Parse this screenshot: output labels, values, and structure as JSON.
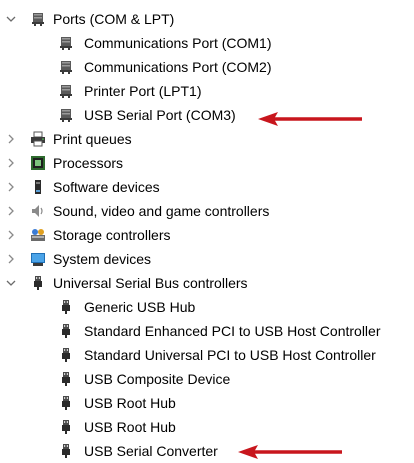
{
  "tree": {
    "ports": {
      "label": "Ports (COM & LPT)",
      "expanded": true,
      "children": [
        "Communications Port (COM1)",
        "Communications Port (COM2)",
        "Printer Port (LPT1)",
        "USB Serial Port (COM3)"
      ]
    },
    "print_queues": {
      "label": "Print queues",
      "expanded": false
    },
    "processors": {
      "label": "Processors",
      "expanded": false
    },
    "software_devices": {
      "label": "Software devices",
      "expanded": false
    },
    "sound": {
      "label": "Sound, video and game controllers",
      "expanded": false
    },
    "storage": {
      "label": "Storage controllers",
      "expanded": false
    },
    "system": {
      "label": "System devices",
      "expanded": false
    },
    "usb": {
      "label": "Universal Serial Bus controllers",
      "expanded": true,
      "children": [
        "Generic USB Hub",
        "Standard Enhanced PCI to USB Host Controller",
        "Standard Universal PCI to USB Host Controller",
        "USB Composite Device",
        "USB Root Hub",
        "USB Root Hub",
        "USB Serial Converter"
      ]
    }
  },
  "icons": {
    "ports_category": "port-connector-icon",
    "port_item": "port-connector-icon",
    "print_queues": "printer-icon",
    "processors": "processor-chip-icon",
    "software_devices": "software-device-icon",
    "sound": "speaker-icon",
    "storage": "storage-controller-icon",
    "system": "system-devices-icon",
    "usb_category": "usb-plug-icon",
    "usb_item": "usb-plug-icon",
    "expand": "chevron-down-icon",
    "collapse": "chevron-right-icon",
    "annotation": "red-arrow-icon"
  },
  "colors": {
    "arrow": "#c8161d",
    "chevron": "#6b6b6b",
    "port_icon": "#4a4a4a"
  }
}
